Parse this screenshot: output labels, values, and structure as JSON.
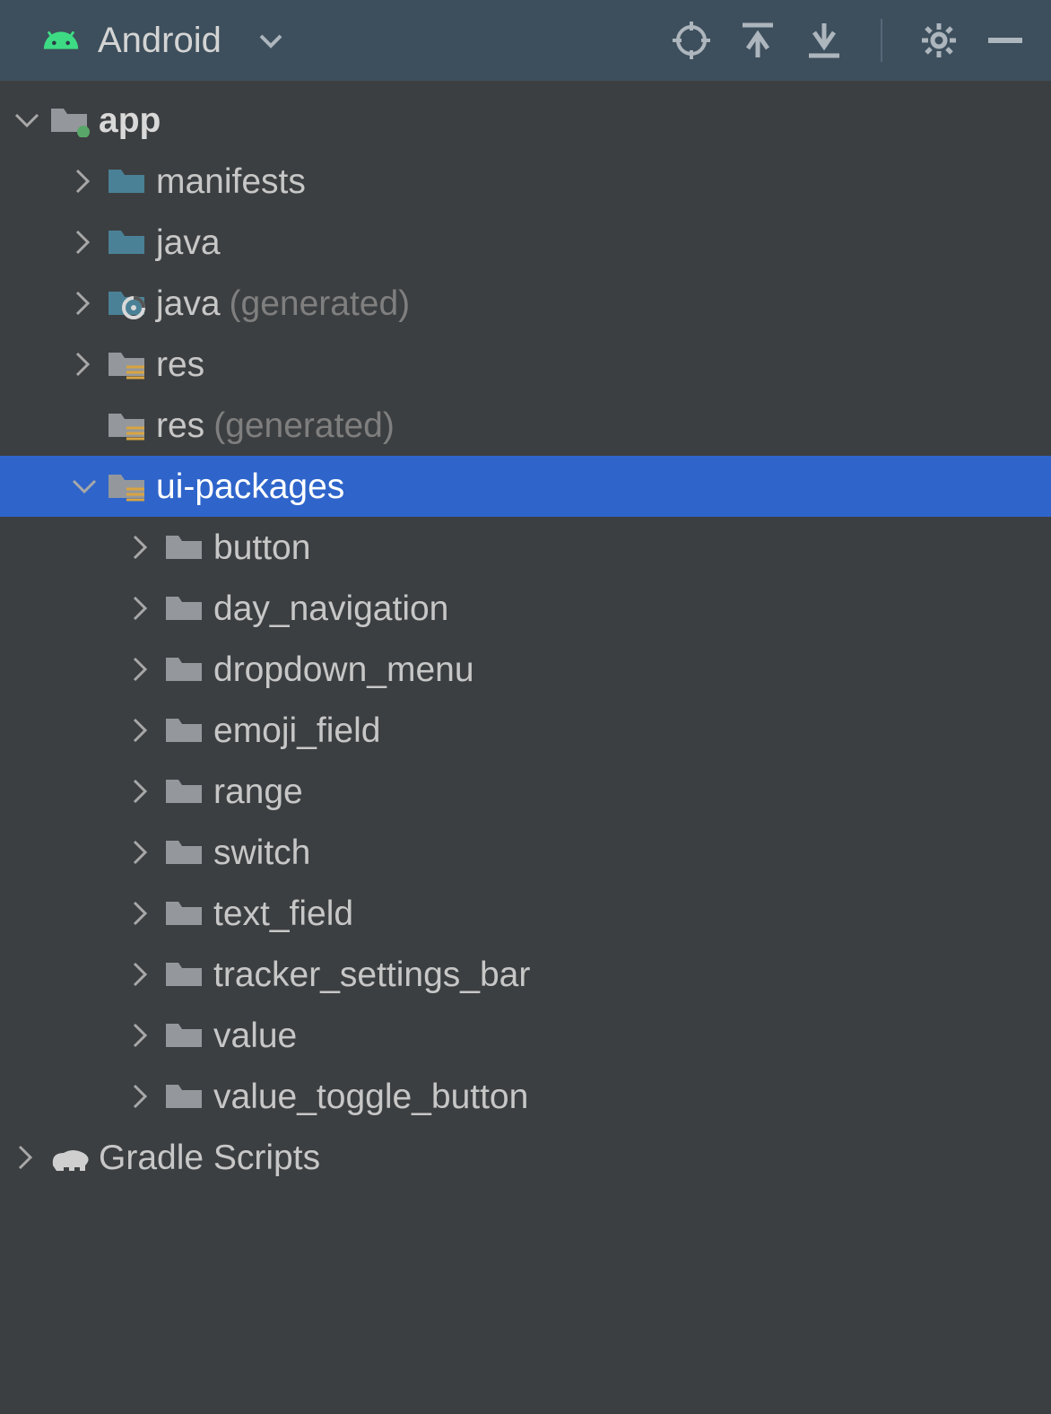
{
  "toolbar": {
    "view_label": "Android"
  },
  "tree": {
    "root": {
      "label": "app"
    },
    "children": [
      {
        "label": "manifests",
        "suffix": ""
      },
      {
        "label": "java",
        "suffix": ""
      },
      {
        "label": "java",
        "suffix": "(generated)"
      },
      {
        "label": "res",
        "suffix": ""
      },
      {
        "label": "res",
        "suffix": "(generated)"
      },
      {
        "label": "ui-packages",
        "suffix": ""
      }
    ],
    "ui_packages": [
      {
        "label": "button"
      },
      {
        "label": "day_navigation"
      },
      {
        "label": "dropdown_menu"
      },
      {
        "label": "emoji_field"
      },
      {
        "label": "range"
      },
      {
        "label": "switch"
      },
      {
        "label": "text_field"
      },
      {
        "label": "tracker_settings_bar"
      },
      {
        "label": "value"
      },
      {
        "label": "value_toggle_button"
      }
    ],
    "gradle": {
      "label": "Gradle Scripts"
    }
  }
}
